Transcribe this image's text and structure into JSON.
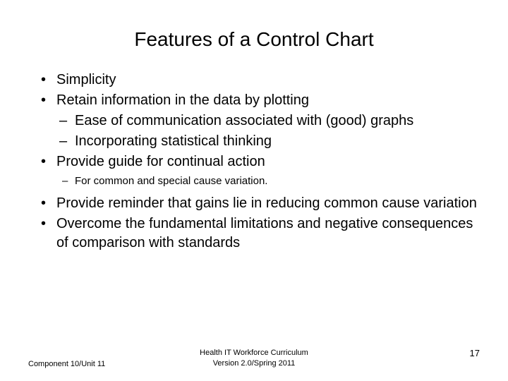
{
  "title": "Features of a Control Chart",
  "bullets": {
    "b1": "Simplicity",
    "b2": "Retain information in the data by plotting",
    "b2_sub1": "Ease of communication associated with (good) graphs",
    "b2_sub2": "Incorporating statistical thinking",
    "b3": "Provide guide for continual action",
    "b3_sub1": "For common and special cause variation.",
    "b4": "Provide reminder that gains lie in reducing common cause variation",
    "b5": "Overcome the fundamental limitations and negative consequences of  comparison with standards"
  },
  "footer": {
    "left": "Component 10/Unit 11",
    "center_line1": "Health IT Workforce Curriculum",
    "center_line2": "Version 2.0/Spring 2011",
    "right": "17"
  }
}
